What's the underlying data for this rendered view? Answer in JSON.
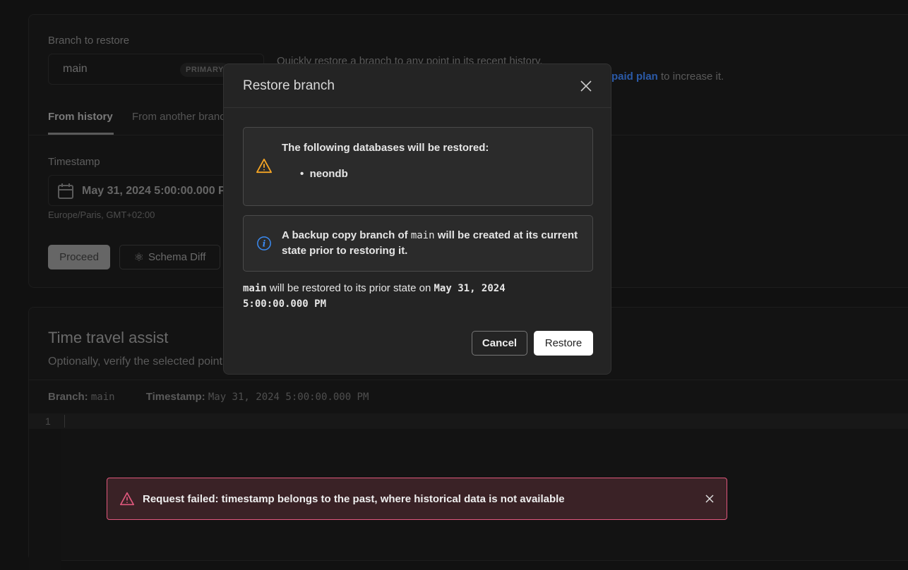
{
  "branch_section": {
    "label": "Branch to restore",
    "branch": "main",
    "badge": "PRIMARY",
    "desc_line1": "Quickly restore a branch to any point in its recent history.",
    "link": "paid plan",
    "desc_line2_suffix": " to increase it."
  },
  "tabs": [
    {
      "label": "From history",
      "active": true
    },
    {
      "label": "From another branch",
      "active": false
    }
  ],
  "timestamp": {
    "label": "Timestamp",
    "value": "May 31, 2024 5:00:00.000 PM",
    "timezone": "Europe/Paris, GMT+02:00"
  },
  "actions": {
    "proceed": "Proceed",
    "schema_diff": "Schema Diff"
  },
  "assist": {
    "title": "Time travel assist",
    "desc": "Optionally, verify the selected point in time",
    "branch_label": "Branch:",
    "branch_value": "main",
    "ts_label": "Timestamp:",
    "ts_value": "May 31, 2024 5:00:00.000 PM",
    "line_number": "1"
  },
  "modal": {
    "title": "Restore branch",
    "warning_title": "The following databases will be restored:",
    "databases": [
      "neondb"
    ],
    "info_pre": "A backup copy branch of ",
    "info_code": "main",
    "info_post": " will be created at its current state prior to restoring it.",
    "summary_code": "main",
    "summary_text": " will be restored to its prior state on ",
    "summary_ts": "May 31, 2024 5:00:00.000 PM",
    "cancel": "Cancel",
    "restore": "Restore"
  },
  "toast": {
    "message": "Request failed: timestamp belongs to the past, where historical data is not available"
  },
  "colors": {
    "warning": "#f5a524",
    "info": "#3b8cf5",
    "error": "#e0587d",
    "link": "#2b5aa8"
  }
}
